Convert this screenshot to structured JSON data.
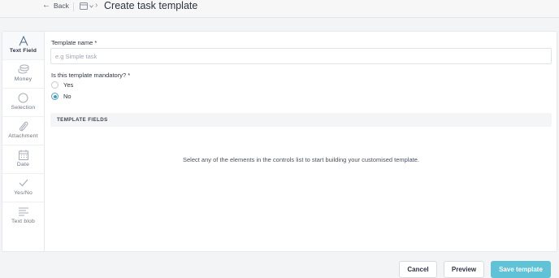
{
  "header": {
    "back_label": "Back",
    "back_icon": "arrow-left-icon",
    "template_icon": "template-switch-icon",
    "title": "Create task template"
  },
  "sidebar": {
    "items": [
      {
        "label": "Text Field",
        "icon": "text-field-icon",
        "active": true
      },
      {
        "label": "Money",
        "icon": "money-icon",
        "active": false
      },
      {
        "label": "Selection",
        "icon": "selection-icon",
        "active": false
      },
      {
        "label": "Attachment",
        "icon": "attachment-icon",
        "active": false
      },
      {
        "label": "Date",
        "icon": "calendar-icon",
        "active": false
      },
      {
        "label": "Yes/No",
        "icon": "check-icon",
        "active": false
      },
      {
        "label": "Text blob",
        "icon": "text-blob-icon",
        "active": false
      }
    ]
  },
  "form": {
    "name_label": "Template name *",
    "name_placeholder": "e.g Simple task",
    "name_value": "",
    "mandatory_label": "Is this template mandatory? *",
    "options": [
      {
        "label": "Yes",
        "checked": false
      },
      {
        "label": "No",
        "checked": true
      }
    ]
  },
  "fields_section": {
    "title": "TEMPLATE FIELDS",
    "empty_message": "Select any of the elements in the controls list to start building your customised template."
  },
  "footer": {
    "cancel_label": "Cancel",
    "preview_label": "Preview",
    "save_label": "Save template"
  },
  "colors": {
    "accent": "#5fc2d6",
    "radio_checked": "#3f9cc4",
    "active_icon": "#4a6b8a"
  }
}
